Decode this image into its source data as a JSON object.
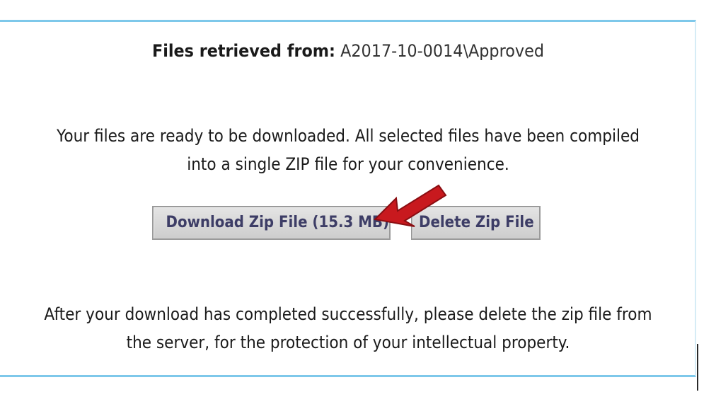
{
  "header": {
    "label": "Files retrieved from:",
    "path": "A2017-10-0014\\Approved"
  },
  "messages": {
    "ready_line1": "Your files are ready to be downloaded. All selected files have been compiled",
    "ready_line2": "into a single ZIP file for your convenience.",
    "after_line1": "After your download has completed successfully, please delete the zip file from",
    "after_line2": "the server, for the protection of your intellectual property."
  },
  "buttons": {
    "download_label": "Download Zip File (15.3 MB)",
    "delete_label": "Delete Zip File"
  },
  "colors": {
    "panel_border": "#7ec8ea",
    "button_text": "#3d3d66",
    "arrow": "#c8191e"
  },
  "icons": {
    "annotation": "red-arrow-icon"
  }
}
